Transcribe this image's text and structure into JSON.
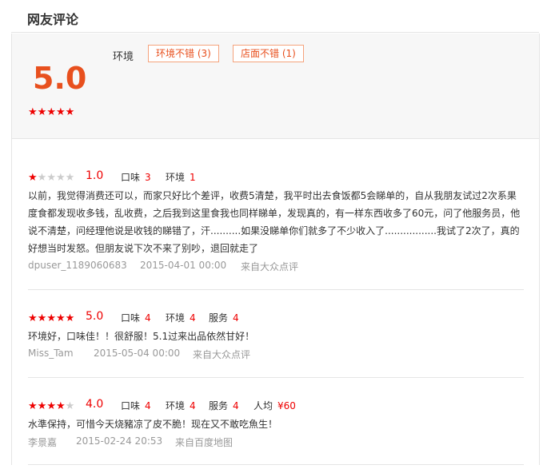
{
  "header": {
    "title": "网友评论"
  },
  "summary": {
    "score": "5.0",
    "stars": 5,
    "tag_label": "环境",
    "tags": [
      "环境不错 (3)",
      "店面不错 (1)"
    ]
  },
  "reviews": [
    {
      "stars": 1,
      "score": "1.0",
      "ratings": [
        {
          "label": "口味",
          "value": "3"
        },
        {
          "label": "环境",
          "value": "1"
        }
      ],
      "text": "以前，我觉得消费还可以，而家只好比个差评，收费5清楚，我平时出去食饭都5会睇单的，自从我朋友试过2次系果度食都发现收多钱，乱收费，之后我到这里食我也同样睇单，发现真的，有一样东西收多了60元，问了他服务员，他说不清楚，问经理他说是收钱的睇错了，汗..........如果没睇单你们就多了不少收入了.................我试了2次了，真的好想当时发怒。但朋友说下次不来了别吵，退回就走了",
      "user": "dpuser_1189060683",
      "date": "2015-04-01 00:00",
      "source": "来自大众点评"
    },
    {
      "stars": 5,
      "score": "5.0",
      "ratings": [
        {
          "label": "口味",
          "value": "4"
        },
        {
          "label": "环境",
          "value": "4"
        },
        {
          "label": "服务",
          "value": "4"
        }
      ],
      "text": "环境好，口味佳！！很舒服！5.1过来出品依然甘好！",
      "user": "Miss_Tam",
      "date": "2015-05-04 00:00",
      "source": "来自大众点评"
    },
    {
      "stars": 4,
      "score": "4.0",
      "ratings": [
        {
          "label": "口味",
          "value": "4"
        },
        {
          "label": "环境",
          "value": "4"
        },
        {
          "label": "服务",
          "value": "4"
        },
        {
          "label": "人均",
          "value": "¥60"
        }
      ],
      "text": "水準保持，可惜今天烧豬凉了皮不脆！现在又不敢吃魚生！",
      "user": "李景嘉",
      "date": "2015-02-24 20:53",
      "source": "来自百度地图"
    }
  ],
  "colors": {
    "accent": "#e8501e",
    "star_on": "#ee0000",
    "star_off": "#cccccc"
  }
}
